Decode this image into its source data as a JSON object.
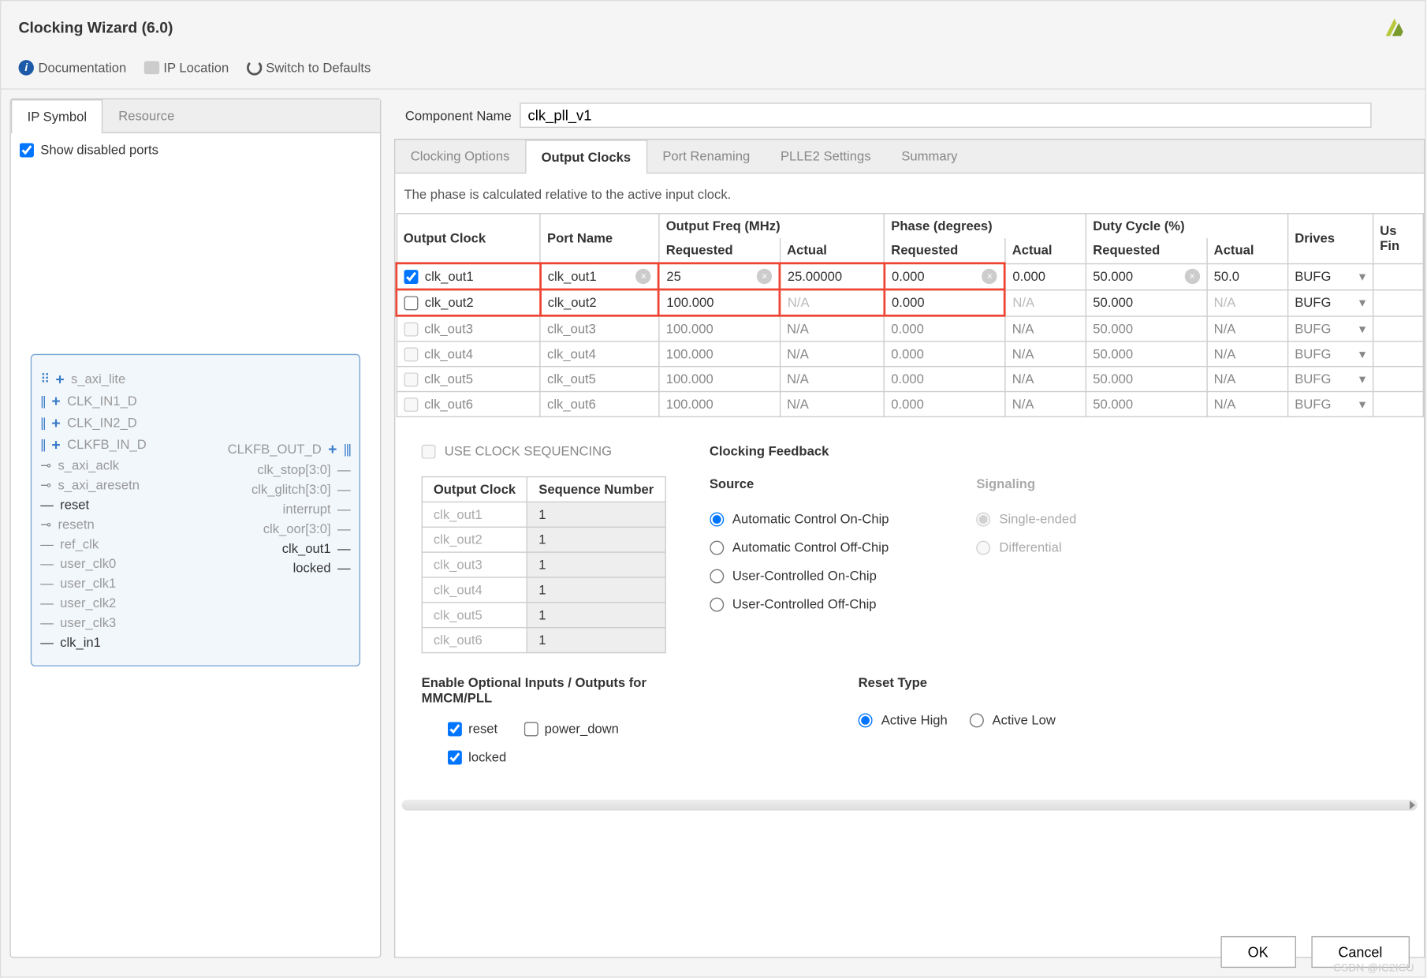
{
  "title": "Clocking Wizard (6.0)",
  "toolbar": {
    "doc": "Documentation",
    "iploc": "IP Location",
    "defaults": "Switch to Defaults"
  },
  "left": {
    "tabs": [
      "IP Symbol",
      "Resource"
    ],
    "active": 0,
    "show_disabled": "Show disabled ports",
    "ports_left_bus": [
      "s_axi_lite",
      "CLK_IN1_D",
      "CLK_IN2_D",
      "CLKFB_IN_D"
    ],
    "ports_left_faded": [
      "s_axi_aclk",
      "s_axi_aresetn"
    ],
    "ports_left_bold1": "reset",
    "ports_left_faded2": [
      "resetn",
      "ref_clk",
      "user_clk0",
      "user_clk1",
      "user_clk2",
      "user_clk3"
    ],
    "ports_left_bold2": "clk_in1",
    "ports_right_top": "CLKFB_OUT_D",
    "ports_right_faded": [
      "clk_stop[3:0]",
      "clk_glitch[3:0]",
      "interrupt",
      "clk_oor[3:0]"
    ],
    "ports_right_bold": [
      "clk_out1",
      "locked"
    ]
  },
  "comp": {
    "label": "Component Name",
    "value": "clk_pll_v1"
  },
  "tabs_r": [
    "Clocking Options",
    "Output Clocks",
    "Port Renaming",
    "PLLE2 Settings",
    "Summary"
  ],
  "active_r": 1,
  "note": "The phase is calculated relative to the active input clock.",
  "headers": {
    "output_clock": "Output Clock",
    "port_name": "Port Name",
    "freq": "Output Freq (MHz)",
    "phase": "Phase (degrees)",
    "duty": "Duty Cycle (%)",
    "drives": "Drives",
    "use_fine": "Us\nFin",
    "requested": "Requested",
    "actual": "Actual"
  },
  "rows": [
    {
      "en": true,
      "name": "clk_out1",
      "port": "clk_out1",
      "freq_req": "25",
      "freq_act": "25.00000",
      "ph_req": "0.000",
      "ph_act": "0.000",
      "duty_req": "50.000",
      "duty_act": "50.0",
      "drives": "BUFG",
      "dim": false,
      "clr": true
    },
    {
      "en": false,
      "name": "clk_out2",
      "port": "clk_out2",
      "freq_req": "100.000",
      "freq_act": "N/A",
      "ph_req": "0.000",
      "ph_act": "N/A",
      "duty_req": "50.000",
      "duty_act": "N/A",
      "drives": "BUFG",
      "dim": false,
      "clr": false
    },
    {
      "en": false,
      "name": "clk_out3",
      "port": "clk_out3",
      "freq_req": "100.000",
      "freq_act": "N/A",
      "ph_req": "0.000",
      "ph_act": "N/A",
      "duty_req": "50.000",
      "duty_act": "N/A",
      "drives": "BUFG",
      "dim": true,
      "clr": false
    },
    {
      "en": false,
      "name": "clk_out4",
      "port": "clk_out4",
      "freq_req": "100.000",
      "freq_act": "N/A",
      "ph_req": "0.000",
      "ph_act": "N/A",
      "duty_req": "50.000",
      "duty_act": "N/A",
      "drives": "BUFG",
      "dim": true,
      "clr": false
    },
    {
      "en": false,
      "name": "clk_out5",
      "port": "clk_out5",
      "freq_req": "100.000",
      "freq_act": "N/A",
      "ph_req": "0.000",
      "ph_act": "N/A",
      "duty_req": "50.000",
      "duty_act": "N/A",
      "drives": "BUFG",
      "dim": true,
      "clr": false
    },
    {
      "en": false,
      "name": "clk_out6",
      "port": "clk_out6",
      "freq_req": "100.000",
      "freq_act": "N/A",
      "ph_req": "0.000",
      "ph_act": "N/A",
      "duty_req": "50.000",
      "duty_act": "N/A",
      "drives": "BUFG",
      "dim": true,
      "clr": false
    }
  ],
  "seq": {
    "title": "USE CLOCK SEQUENCING",
    "h1": "Output Clock",
    "h2": "Sequence Number",
    "rows": [
      {
        "name": "clk_out1",
        "val": "1"
      },
      {
        "name": "clk_out2",
        "val": "1"
      },
      {
        "name": "clk_out3",
        "val": "1"
      },
      {
        "name": "clk_out4",
        "val": "1"
      },
      {
        "name": "clk_out5",
        "val": "1"
      },
      {
        "name": "clk_out6",
        "val": "1"
      }
    ]
  },
  "fb": {
    "title": "Clocking Feedback",
    "source": "Source",
    "signaling": "Signaling",
    "opts_source": [
      "Automatic Control On-Chip",
      "Automatic Control Off-Chip",
      "User-Controlled On-Chip",
      "User-Controlled Off-Chip"
    ],
    "opts_sig": [
      "Single-ended",
      "Differential"
    ],
    "sel_source": 0,
    "sel_sig": 0
  },
  "optional": {
    "title": "Enable Optional Inputs / Outputs for MMCM/PLL",
    "reset": "reset",
    "power_down": "power_down",
    "locked": "locked"
  },
  "reset": {
    "title": "Reset Type",
    "high": "Active High",
    "low": "Active Low"
  },
  "buttons": {
    "ok": "OK",
    "cancel": "Cancel"
  },
  "watermark": "CSDN @IC2ICU"
}
